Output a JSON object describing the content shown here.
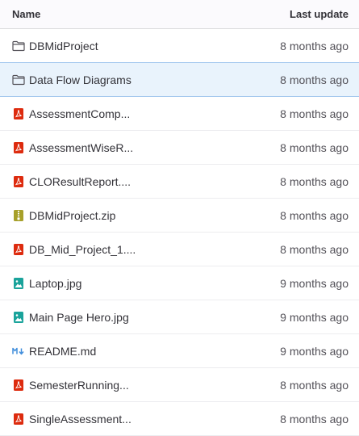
{
  "header": {
    "name_label": "Name",
    "updated_label": "Last update"
  },
  "files": [
    {
      "name": "DBMidProject",
      "updated": "8 months ago",
      "icon": "folder-icon"
    },
    {
      "name": "Data Flow Diagrams",
      "updated": "8 months ago",
      "icon": "folder-icon"
    },
    {
      "name": "AssessmentComp...",
      "updated": "8 months ago",
      "icon": "pdf-icon"
    },
    {
      "name": "AssessmentWiseR...",
      "updated": "8 months ago",
      "icon": "pdf-icon"
    },
    {
      "name": "CLOResultReport....",
      "updated": "8 months ago",
      "icon": "pdf-icon"
    },
    {
      "name": "DBMidProject.zip",
      "updated": "8 months ago",
      "icon": "archive-icon"
    },
    {
      "name": "DB_Mid_Project_1....",
      "updated": "8 months ago",
      "icon": "pdf-icon"
    },
    {
      "name": "Laptop.jpg",
      "updated": "9 months ago",
      "icon": "image-icon"
    },
    {
      "name": "Main Page Hero.jpg",
      "updated": "9 months ago",
      "icon": "image-icon"
    },
    {
      "name": "README.md",
      "updated": "9 months ago",
      "icon": "markdown-icon"
    },
    {
      "name": "SemesterRunning...",
      "updated": "8 months ago",
      "icon": "pdf-icon"
    },
    {
      "name": "SingleAssessment...",
      "updated": "8 months ago",
      "icon": "pdf-icon"
    }
  ],
  "colors": {
    "folder": "#535158",
    "pdf": "#dd2b0e",
    "archive": "#a7a02a",
    "image": "#1aa39b",
    "markdown": "#428fdc",
    "selected_row": "#e9f3fc"
  }
}
